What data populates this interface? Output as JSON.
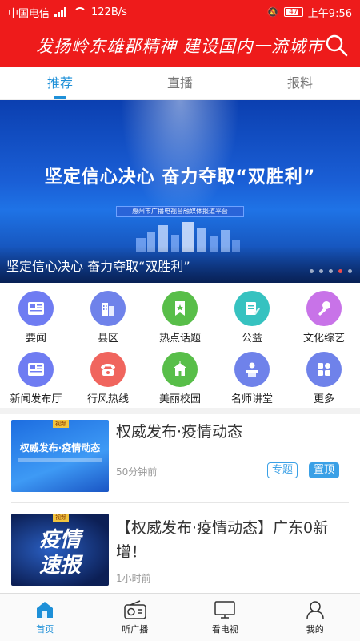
{
  "status": {
    "carrier": "中国电信",
    "network": "4G",
    "speed": "122B/s",
    "battery": "47",
    "time": "上午9:56"
  },
  "header": {
    "slogan": "发扬岭东雄郡精神  建设国内一流城市",
    "search_icon": "search-icon"
  },
  "tabs": [
    {
      "label": "推荐",
      "active": true
    },
    {
      "label": "直播",
      "active": false
    },
    {
      "label": "报料",
      "active": false
    }
  ],
  "banner": {
    "headline": "坚定信心决心  奋力夺取“双胜利”",
    "platform": "惠州市广播电视台融媒体报道平台",
    "caption": "坚定信心决心 奋力夺取“双胜利”",
    "dot_count": 5,
    "active_dot": 4
  },
  "grid": [
    {
      "label": "要闻",
      "icon": "newspaper-icon",
      "color": "#6f7cf2"
    },
    {
      "label": "县区",
      "icon": "buildings-icon",
      "color": "#6f82ea"
    },
    {
      "label": "热点话题",
      "icon": "bookmark-star-icon",
      "color": "#58be49"
    },
    {
      "label": "公益",
      "icon": "note-pen-icon",
      "color": "#36c2c0"
    },
    {
      "label": "文化综艺",
      "icon": "microphone-icon",
      "color": "#c873e8"
    },
    {
      "label": "新闻发布厅",
      "icon": "newspaper-icon",
      "color": "#6f7cf2"
    },
    {
      "label": "行风热线",
      "icon": "telephone-icon",
      "color": "#f0655e"
    },
    {
      "label": "美丽校园",
      "icon": "school-icon",
      "color": "#58be49"
    },
    {
      "label": "名师讲堂",
      "icon": "lecturer-icon",
      "color": "#6f82ea"
    },
    {
      "label": "更多",
      "icon": "more-grid-icon",
      "color": "#6f82ea"
    }
  ],
  "news": [
    {
      "title": "权威发布·疫情动态",
      "time": "50分钟前",
      "tag_topic": "专题",
      "tag_pinned": "置顶",
      "thumb_title": "权威发布·疫情动态",
      "thumb_badge": "视频"
    },
    {
      "title": "【权威发布·疫情动态】广东0新增！",
      "time": "1小时前",
      "thumb_title_line1": "疫情",
      "thumb_title_line2": "速报",
      "thumb_badge": "视频"
    }
  ],
  "bottom_nav": [
    {
      "label": "首页",
      "icon": "home-icon",
      "active": true
    },
    {
      "label": "听广播",
      "icon": "radio-icon",
      "active": false
    },
    {
      "label": "看电视",
      "icon": "tv-icon",
      "active": false
    },
    {
      "label": "我的",
      "icon": "user-icon",
      "active": false
    }
  ],
  "colors": {
    "brand_red": "#ee1b1b",
    "accent_blue": "#1e90d8"
  }
}
